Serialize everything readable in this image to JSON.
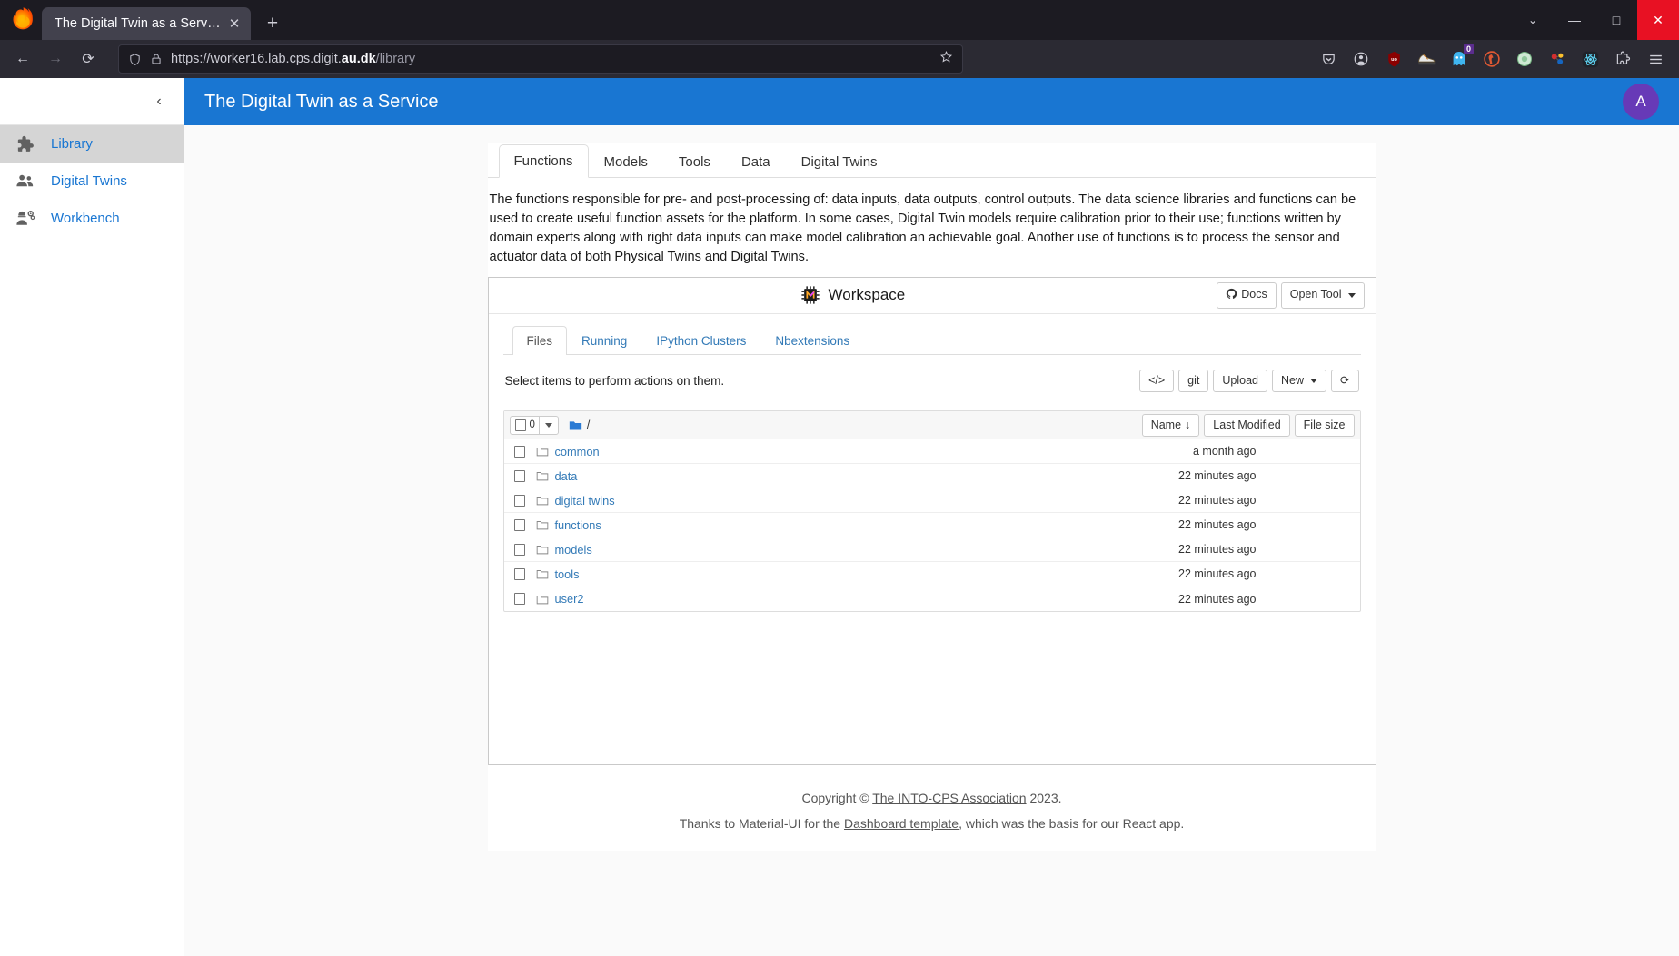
{
  "browser": {
    "tab_title": "The Digital Twin as a Service",
    "close_tab_glyph": "✕",
    "new_tab_glyph": "+",
    "window_controls": {
      "chevron": "⌄",
      "minimize": "—",
      "maximize": "□",
      "close": "✕"
    },
    "nav": {
      "back": "←",
      "forward": "→",
      "reload": "⟳"
    },
    "url_prefix": "https://worker16.lab.cps.digit.",
    "url_bold": "au.dk",
    "url_suffix": "/library",
    "extensions": [
      {
        "name": "pocket-icon",
        "badge": ""
      },
      {
        "name": "account-icon",
        "badge": ""
      },
      {
        "name": "ublock-origin-icon",
        "badge": ""
      },
      {
        "name": "sneaker-extension-icon",
        "badge": ""
      },
      {
        "name": "ghost-extension-icon",
        "badge": "0"
      },
      {
        "name": "duckduckgo-icon",
        "badge": ""
      },
      {
        "name": "green-circle-extension-icon",
        "badge": ""
      },
      {
        "name": "molecule-extension-icon",
        "badge": ""
      },
      {
        "name": "react-devtools-icon",
        "badge": ""
      },
      {
        "name": "extensions-puzzle-icon",
        "badge": ""
      },
      {
        "name": "app-menu-icon",
        "badge": ""
      }
    ]
  },
  "sidebar": {
    "collapse_glyph": "‹",
    "items": [
      {
        "label": "Library",
        "icon": "puzzle-icon",
        "active": true
      },
      {
        "label": "Digital Twins",
        "icon": "people-icon",
        "active": false
      },
      {
        "label": "Workbench",
        "icon": "engineer-icon",
        "active": false
      }
    ]
  },
  "appbar": {
    "title": "The Digital Twin as a Service",
    "avatar_letter": "A",
    "bg_color": "#1976d2",
    "avatar_color": "#673ab7"
  },
  "main": {
    "tabs": [
      {
        "label": "Functions",
        "active": true
      },
      {
        "label": "Models",
        "active": false
      },
      {
        "label": "Tools",
        "active": false
      },
      {
        "label": "Data",
        "active": false
      },
      {
        "label": "Digital Twins",
        "active": false
      }
    ],
    "description": "The functions responsible for pre- and post-processing of: data inputs, data outputs, control outputs. The data science libraries and functions can be used to create useful function assets for the platform. In some cases, Digital Twin models require calibration prior to their use; functions written by domain experts along with right data inputs can make model calibration an achievable goal. Another use of functions is to process the sensor and actuator data of both Physical Twins and Digital Twins."
  },
  "workspace": {
    "title": "Workspace",
    "icon": "chip-icon",
    "docs_label": "Docs",
    "docs_icon": "github-icon",
    "open_tool_label": "Open Tool",
    "jupyter_tabs": [
      {
        "label": "Files",
        "active": true
      },
      {
        "label": "Running",
        "active": false
      },
      {
        "label": "IPython Clusters",
        "active": false
      },
      {
        "label": "Nbextensions",
        "active": false
      }
    ],
    "toolbar_hint": "Select items to perform actions on them.",
    "toolbar_buttons": [
      {
        "label": "</>",
        "name": "code-button"
      },
      {
        "label": "git",
        "name": "git-button"
      },
      {
        "label": "Upload",
        "name": "upload-button"
      },
      {
        "label": "New",
        "name": "new-button",
        "caret": true
      },
      {
        "label": "⟳",
        "name": "refresh-button"
      }
    ],
    "file_table": {
      "selected_count": "0",
      "path": "/",
      "columns": [
        {
          "label": "Name",
          "sorted": true,
          "sort_glyph": "↓"
        },
        {
          "label": "Last Modified",
          "sorted": false
        },
        {
          "label": "File size",
          "sorted": false
        }
      ],
      "rows": [
        {
          "name": "common",
          "modified": "a month ago",
          "size": ""
        },
        {
          "name": "data",
          "modified": "22 minutes ago",
          "size": ""
        },
        {
          "name": "digital twins",
          "modified": "22 minutes ago",
          "size": ""
        },
        {
          "name": "functions",
          "modified": "22 minutes ago",
          "size": ""
        },
        {
          "name": "models",
          "modified": "22 minutes ago",
          "size": ""
        },
        {
          "name": "tools",
          "modified": "22 minutes ago",
          "size": ""
        },
        {
          "name": "user2",
          "modified": "22 minutes ago",
          "size": ""
        }
      ]
    }
  },
  "footer": {
    "copyright_prefix": "Copyright © ",
    "copyright_link": "The INTO-CPS Association",
    "copyright_suffix": " 2023.",
    "credit_prefix": "Thanks to Material-UI for the ",
    "credit_link": "Dashboard template",
    "credit_suffix": ", which was the basis for our React app."
  }
}
